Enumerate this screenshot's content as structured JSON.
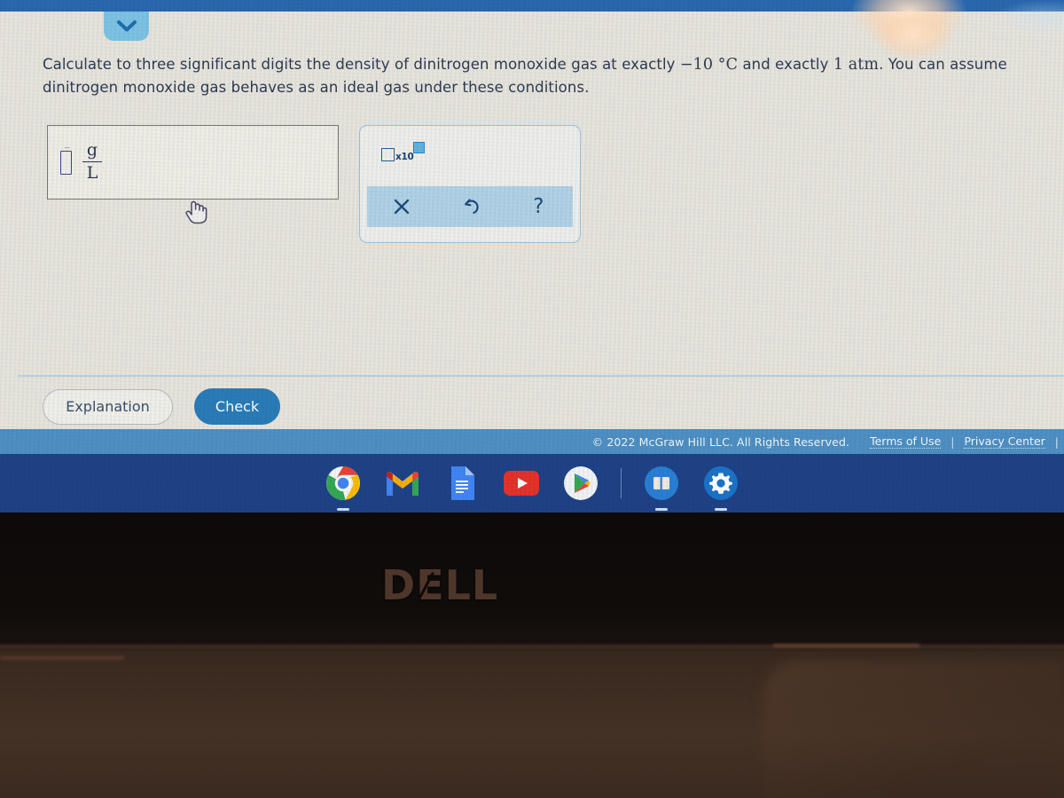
{
  "device": {
    "brand_logo": "DELL",
    "bezel_label": "laptop-bezel"
  },
  "browser": {
    "top_bar_color": "#2a68b0",
    "collapse_tab_icon": "chevron-down-icon"
  },
  "question": {
    "line1_a": "Calculate to three significant digits the density of dinitrogen monoxide gas at exactly ",
    "temperature": "−10 °C",
    "line1_b": " and exactly ",
    "pressure": "1 atm",
    "line1_c": ". You can",
    "line2": "assume dinitrogen monoxide gas behaves as an ideal gas under these conditions."
  },
  "answer": {
    "input_value": "",
    "input_placeholder": "",
    "unit_numerator": "g",
    "unit_denominator": "L",
    "cursor_icon": "pointing-hand-cursor"
  },
  "toolbar": {
    "scientific_notation": {
      "label": "x10",
      "name": "scientific-notation-button"
    },
    "actions": [
      {
        "name": "clear-button",
        "glyph": "✕",
        "label": "Clear"
      },
      {
        "name": "undo-button",
        "glyph": "↺",
        "label": "Undo"
      },
      {
        "name": "help-button",
        "glyph": "?",
        "label": "Help"
      }
    ]
  },
  "buttons": {
    "explanation_label": "Explanation",
    "check_label": "Check",
    "check_color": "#2a7cb8"
  },
  "footer": {
    "copyright": "© 2022 McGraw Hill LLC. All Rights Reserved.",
    "links": [
      {
        "label": "Terms of Use"
      },
      {
        "label": "Privacy Center"
      }
    ],
    "separator": "|",
    "bar_color": "#4f90c4"
  },
  "shelf": {
    "bar_color": "#1f4287",
    "items": [
      {
        "name": "chrome-icon",
        "label": "Chrome"
      },
      {
        "name": "gmail-icon",
        "label": "Gmail"
      },
      {
        "name": "google-docs-icon",
        "label": "Docs"
      },
      {
        "name": "youtube-icon",
        "label": "YouTube"
      },
      {
        "name": "play-store-icon",
        "label": "Play Store"
      },
      {
        "name": "files-icon",
        "label": "Files"
      },
      {
        "name": "settings-icon",
        "label": "Settings"
      }
    ]
  }
}
